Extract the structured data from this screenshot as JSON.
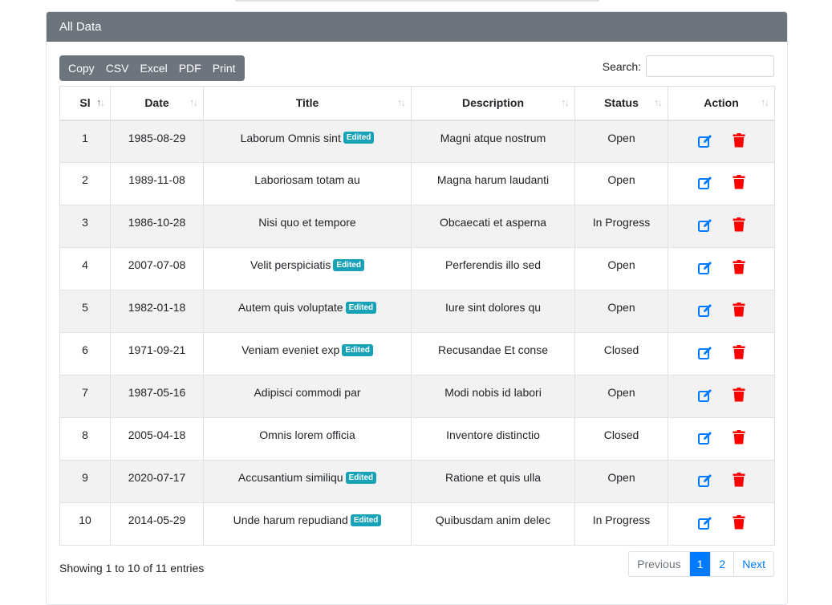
{
  "card": {
    "title": "All Data"
  },
  "toolbar": {
    "buttons": [
      "Copy",
      "CSV",
      "Excel",
      "PDF",
      "Print"
    ]
  },
  "search": {
    "label": "Search:",
    "value": "",
    "placeholder": ""
  },
  "table": {
    "columns": [
      "Sl",
      "Date",
      "Title",
      "Description",
      "Status",
      "Action"
    ],
    "rows": [
      {
        "sl": "1",
        "date": "1985-08-29",
        "title": "Laborum Omnis sint",
        "edited": true,
        "description": "Magni atque nostrum",
        "status": "Open"
      },
      {
        "sl": "2",
        "date": "1989-11-08",
        "title": "Laboriosam totam au",
        "edited": false,
        "description": "Magna harum laudanti",
        "status": "Open"
      },
      {
        "sl": "3",
        "date": "1986-10-28",
        "title": "Nisi quo et tempore",
        "edited": false,
        "description": "Obcaecati et asperna",
        "status": "In Progress"
      },
      {
        "sl": "4",
        "date": "2007-07-08",
        "title": "Velit perspiciatis",
        "edited": true,
        "description": "Perferendis illo sed",
        "status": "Open"
      },
      {
        "sl": "5",
        "date": "1982-01-18",
        "title": "Autem quis voluptate",
        "edited": true,
        "description": "Iure sint dolores qu",
        "status": "Open"
      },
      {
        "sl": "6",
        "date": "1971-09-21",
        "title": "Veniam eveniet exp",
        "edited": true,
        "description": "Recusandae Et conse",
        "status": "Closed"
      },
      {
        "sl": "7",
        "date": "1987-05-16",
        "title": "Adipisci commodi par",
        "edited": false,
        "description": "Modi nobis id labori",
        "status": "Open"
      },
      {
        "sl": "8",
        "date": "2005-04-18",
        "title": "Omnis lorem officia",
        "edited": false,
        "description": "Inventore distinctio",
        "status": "Closed"
      },
      {
        "sl": "9",
        "date": "2020-07-17",
        "title": "Accusantium similiqu",
        "edited": true,
        "description": "Ratione et quis ulla",
        "status": "Open"
      },
      {
        "sl": "10",
        "date": "2014-05-29",
        "title": "Unde harum repudiand",
        "edited": true,
        "description": "Quibusdam anim delec",
        "status": "In Progress"
      }
    ],
    "badge_label": "Edited"
  },
  "icons": {
    "edit": "edit-icon",
    "delete": "trash-icon",
    "sort": "sort-icon"
  },
  "colors": {
    "header": "#6c757d",
    "edit": "#007bff",
    "delete": "#ff0000",
    "badge": "#17a2b8",
    "active_page": "#007bff"
  },
  "footer": {
    "info": "Showing 1 to 10 of 11 entries"
  },
  "pagination": {
    "previous": "Previous",
    "pages": [
      "1",
      "2"
    ],
    "active": "1",
    "next": "Next"
  }
}
